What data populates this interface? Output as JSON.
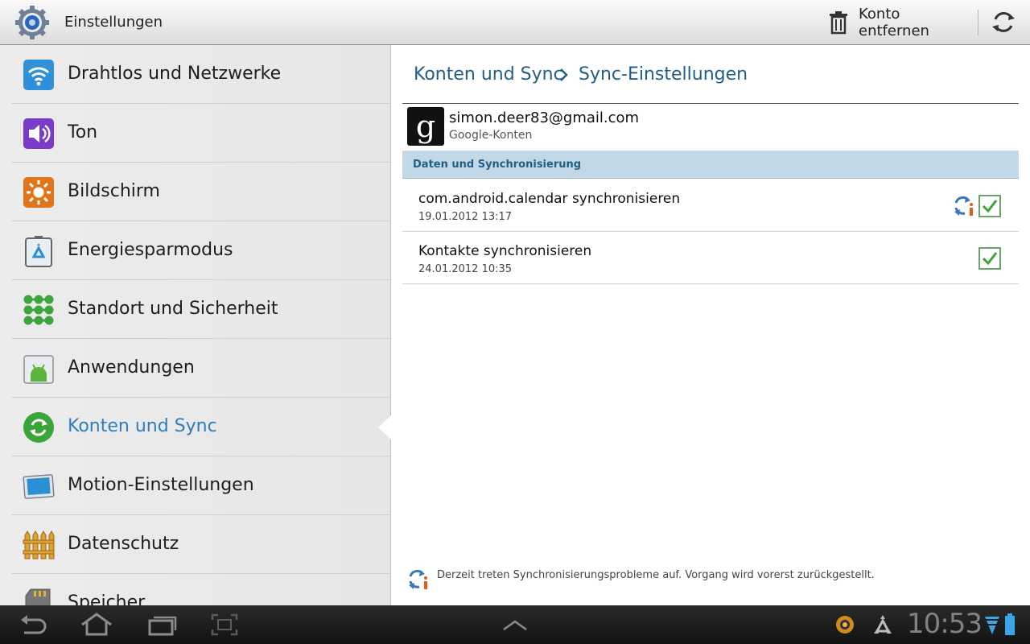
{
  "action_bar": {
    "title": "Einstellungen",
    "remove_account_label": "Konto entfernen",
    "icons": [
      "settings-gear-icon",
      "trash-icon",
      "refresh-icon"
    ]
  },
  "sidebar": {
    "items": [
      {
        "label": "Drahtlos und Netzwerke",
        "icon": "wifi-icon"
      },
      {
        "label": "Ton",
        "icon": "speaker-icon"
      },
      {
        "label": "Bildschirm",
        "icon": "brightness-icon"
      },
      {
        "label": "Energiesparmodus",
        "icon": "recycle-battery-icon"
      },
      {
        "label": "Standort und Sicherheit",
        "icon": "location-grid-icon"
      },
      {
        "label": "Anwendungen",
        "icon": "android-icon"
      },
      {
        "label": "Konten und Sync",
        "icon": "sync-icon",
        "selected": true
      },
      {
        "label": "Motion-Einstellungen",
        "icon": "motion-tablet-icon"
      },
      {
        "label": "Datenschutz",
        "icon": "fence-icon"
      },
      {
        "label": "Speicher",
        "icon": "sd-card-icon"
      }
    ],
    "selected_color": "#2f7cbf"
  },
  "main": {
    "breadcrumb": {
      "parent": "Konten und Sync",
      "current": "Sync-Einstellungen"
    },
    "account": {
      "email": "simon.deer83@gmail.com",
      "type": "Google-Konten",
      "icon_letter": "g"
    },
    "section_header": "Daten und Synchronisierung",
    "sync_items": [
      {
        "title": "com.android.calendar synchronisieren",
        "date": "19.01.2012 13:17",
        "checked": true,
        "has_status_icon": true
      },
      {
        "title": "Kontakte synchronisieren",
        "date": "24.01.2012 10:35",
        "checked": true,
        "has_status_icon": false
      }
    ],
    "footer_note": "Derzeit treten Synchronisierungsprobleme auf. Vorgang wird vorerst zurückgestellt."
  },
  "system_bar": {
    "clock": "10:53",
    "icons": [
      "back-icon",
      "home-icon",
      "recent-apps-icon",
      "screenshot-icon",
      "expand-up-icon",
      "notification-circle-icon",
      "recycle-icon",
      "wifi-signal-icon",
      "battery-icon"
    ]
  }
}
